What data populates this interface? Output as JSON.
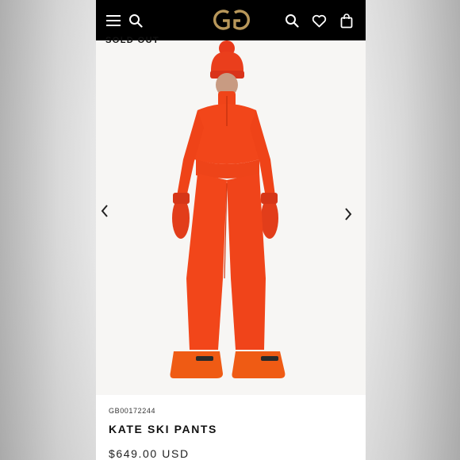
{
  "header": {
    "logo_text": "GG",
    "icons": [
      "menu-icon",
      "search-icon",
      "logo",
      "search-icon",
      "heart-icon",
      "bag-icon"
    ]
  },
  "product": {
    "badge": "SOLD OUT",
    "sku": "GB00172244",
    "title": "KATE SKI PANTS",
    "price": "$649.00 USD"
  },
  "colors": {
    "header_bg": "#000000",
    "logo_gold": "#b8975a",
    "garment_orange": "#f2461a"
  }
}
